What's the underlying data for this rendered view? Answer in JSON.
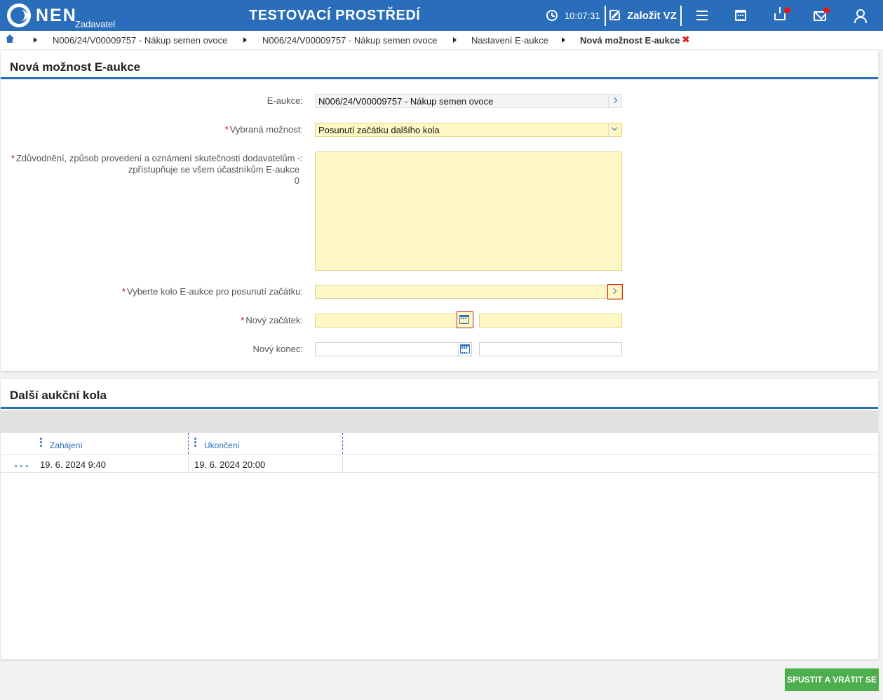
{
  "header": {
    "brand": "NEN",
    "brand_sub": "Zadavatel",
    "env_title": "TESTOVACÍ PROSTŘEDÍ",
    "clock": "10:07:31",
    "create_label": "Založit VZ"
  },
  "breadcrumb": {
    "items": [
      "N006/24/V00009757 - Nákup semen ovoce",
      "N006/24/V00009757 - Nákup semen ovoce",
      "Nastavení E-aukce",
      "Nová možnost E-aukce"
    ],
    "close": "✖"
  },
  "form": {
    "title": "Nová možnost E-aukce",
    "required_mark": "*",
    "eauction_label": "E-aukce:",
    "eauction_value": "N006/24/V00009757 - Nákup semen ovoce",
    "option_label": "Vybraná možnost:",
    "option_value": "Posunutí začátku dalšího kola",
    "reason_label_1": "Zdůvodnění, způsob provedení a oznámení skutečnosti dodavatelům -:",
    "reason_label_2": "zpřístupňuje se všem účastníkům E-aukce",
    "reason_label_3": "0",
    "reason_value": "",
    "round_label": "Vyberte kolo E-aukce pro posunutí začátku:",
    "round_value": "",
    "new_start_label": "Nový začátek:",
    "new_start_date": "",
    "new_start_time": "",
    "new_end_label": "Nový konec:",
    "new_end_date": "",
    "new_end_time": ""
  },
  "rounds": {
    "title": "Další aukční kola",
    "columns": [
      "Zahájení",
      "Ukončení"
    ],
    "rows": [
      {
        "menu": "∘∘∘",
        "start": "19. 6. 2024 9:40",
        "end": "19. 6. 2024 20:00"
      }
    ]
  },
  "footer": {
    "submit_label": "SPUSTIT A VRÁTIT SE"
  },
  "colors": {
    "primary": "#2a6ebb",
    "required_bg": "#fff8c4",
    "submit": "#4cae4c",
    "alert": "#e01b1b"
  }
}
